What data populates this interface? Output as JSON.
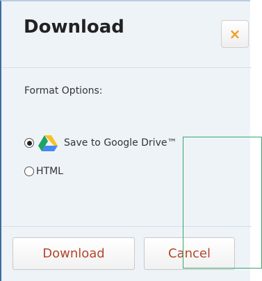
{
  "dialog": {
    "title": "Download",
    "close_label": "×",
    "format_label": "Format Options:",
    "options": [
      {
        "label": "Save to Google Drive™",
        "selected": true,
        "icon": "google-drive-icon"
      },
      {
        "label": "HTML",
        "selected": false
      }
    ],
    "download_label": "Download",
    "cancel_label": "Cancel"
  },
  "colors": {
    "accent_border": "#3b6f9e",
    "button_text": "#b5462a",
    "close_icon": "#f0a020",
    "tooltip_border": "#35a56a"
  }
}
